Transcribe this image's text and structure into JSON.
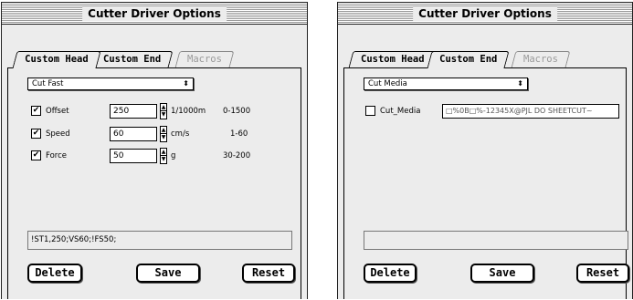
{
  "windows": [
    {
      "title": "Cutter Driver Options",
      "tabs": [
        "Custom Head",
        "Custom End",
        "Macros"
      ],
      "popup_value": "Cut Fast",
      "rows": [
        {
          "label": "Offset",
          "value": "250",
          "unit": "1/1000m",
          "range": "0-1500",
          "checked": true
        },
        {
          "label": "Speed",
          "value": "60",
          "unit": "cm/s",
          "range": "1-60",
          "checked": true
        },
        {
          "label": "Force",
          "value": "50",
          "unit": "g",
          "range": "30-200",
          "checked": true
        }
      ],
      "command": "!ST1,250;VS60;!FS50;",
      "buttons": {
        "delete": "Delete",
        "save": "Save",
        "reset": "Reset"
      }
    },
    {
      "title": "Cutter Driver Options",
      "tabs": [
        "Custom Head",
        "Custom End",
        "Macros"
      ],
      "popup_value": "Cut Media",
      "media_row": {
        "label": "Cut_Media",
        "value": "□%0B□%-12345X@PJL DO SHEETCUT~",
        "checked": false
      },
      "command": "",
      "buttons": {
        "delete": "Delete",
        "save": "Save",
        "reset": "Reset"
      }
    }
  ],
  "glyphs": {
    "check": "✔",
    "popup_arrows": "⬍",
    "up": "▲",
    "down": "▼"
  }
}
